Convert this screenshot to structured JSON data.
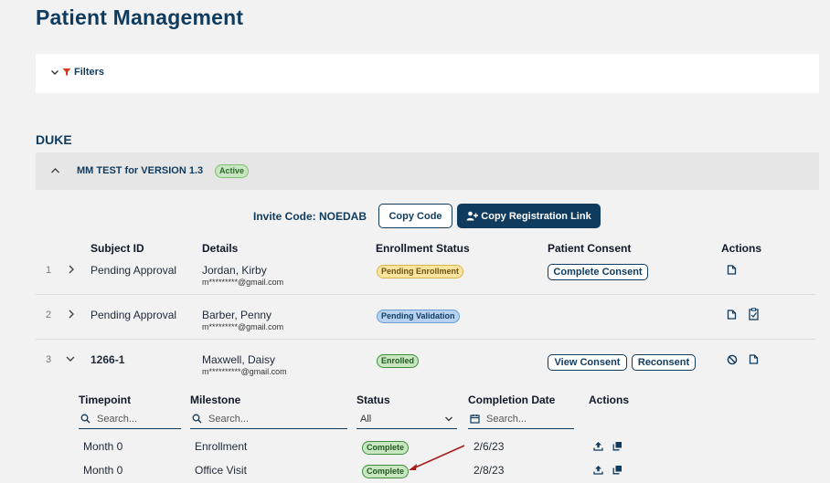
{
  "page": {
    "title": "Patient Management"
  },
  "filters": {
    "label": "Filters"
  },
  "organization": {
    "name": "DUKE"
  },
  "study": {
    "name": "MM TEST for VERSION 1.3",
    "status": "Active"
  },
  "invite": {
    "label": "Invite Code: NOEDAB",
    "copy_code_label": "Copy Code",
    "copy_link_label": "Copy Registration Link"
  },
  "patients_table": {
    "headers": [
      "Subject ID",
      "Details",
      "Enrollment Status",
      "Patient Consent",
      "Actions"
    ],
    "rows": [
      {
        "num": "1",
        "subject_id": "Pending Approval",
        "name": "Jordan, Kirby",
        "email": "m*********@gmail.com",
        "status": "Pending Enrollment",
        "consent": [
          "Complete Consent"
        ]
      },
      {
        "num": "2",
        "subject_id": "Pending Approval",
        "name": "Barber, Penny",
        "email": "m*********@gmail.com",
        "status": "Pending Validation",
        "consent": []
      },
      {
        "num": "3",
        "subject_id": "1266-1",
        "name": "Maxwell, Daisy",
        "email": "m**********@gmail.com",
        "status": "Enrolled",
        "consent": [
          "View Consent",
          "Reconsent"
        ]
      }
    ]
  },
  "milestones_table": {
    "headers": [
      "Timepoint",
      "Milestone",
      "Status",
      "Completion Date",
      "Actions"
    ],
    "search_placeholder": "Search...",
    "status_filter": "All",
    "rows": [
      {
        "timepoint": "Month 0",
        "milestone": "Enrollment",
        "status": "Complete",
        "date": "2/6/23"
      },
      {
        "timepoint": "Month 0",
        "milestone": "Office Visit",
        "status": "Complete",
        "date": "2/8/23"
      }
    ]
  },
  "colors": {
    "primary": "#0f3b5f",
    "filter_icon": "#d9381e",
    "arrow": "#a61b1b"
  },
  "icons": [
    "chevron-down-icon",
    "filter-icon",
    "chevron-up-icon",
    "user-plus-icon",
    "chevron-right-icon",
    "document-icon",
    "clipboard-check-icon",
    "block-icon",
    "search-icon",
    "calendar-icon",
    "upload-icon",
    "copy-icon"
  ]
}
